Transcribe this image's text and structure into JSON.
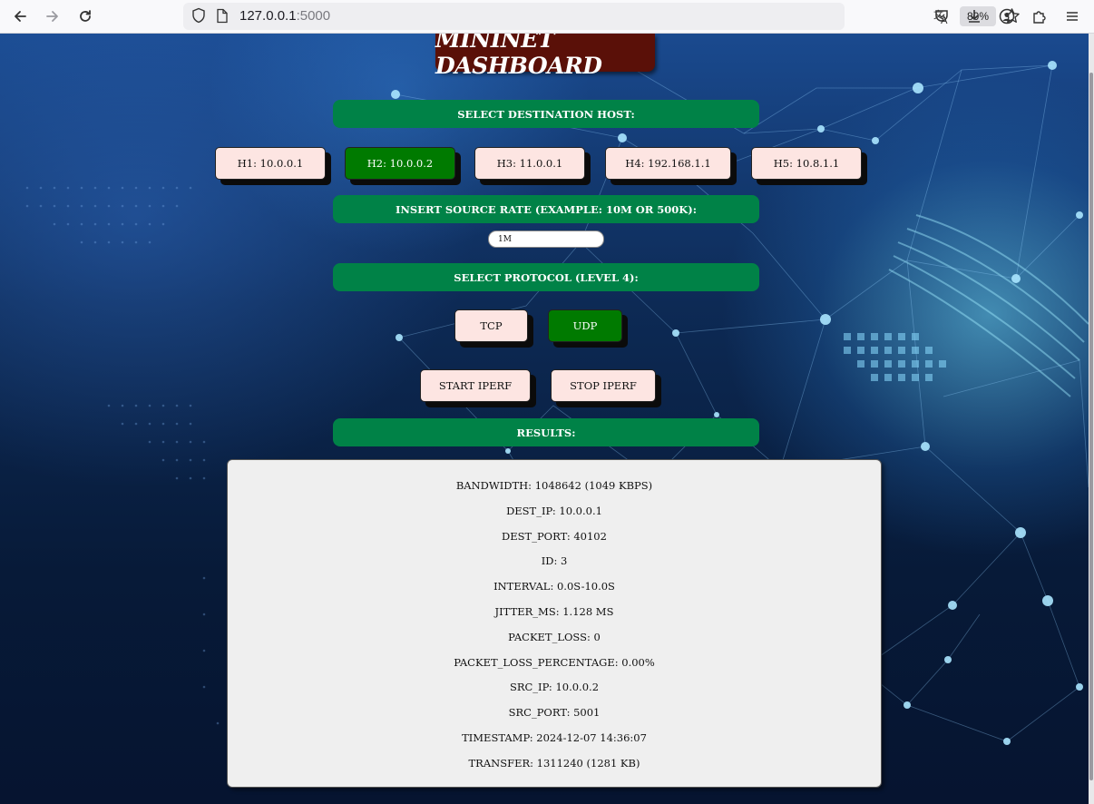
{
  "browser": {
    "url_host": "127.0.0.1",
    "url_port": ":5000",
    "zoom": "80%"
  },
  "page": {
    "title": "MININET DASHBOARD",
    "sections": {
      "destination": "SELECT DESTINATION HOST:",
      "rate": "INSERT SOURCE RATE (EXAMPLE: 10M OR 500K):",
      "protocol": "SELECT PROTOCOL (LEVEL 4):",
      "results": "RESULTS:"
    },
    "hosts": [
      {
        "label": "H1: 10.0.0.1",
        "selected": false
      },
      {
        "label": "H2: 10.0.0.2",
        "selected": true
      },
      {
        "label": "H3: 11.0.0.1",
        "selected": false
      },
      {
        "label": "H4: 192.168.1.1",
        "selected": false
      },
      {
        "label": "H5: 10.8.1.1",
        "selected": false
      }
    ],
    "rate_value": "1M",
    "protocols": [
      {
        "label": "TCP",
        "selected": false
      },
      {
        "label": "UDP",
        "selected": true
      }
    ],
    "actions": {
      "start": "START IPERF",
      "stop": "STOP IPERF"
    },
    "results": [
      "BANDWIDTH: 1048642 (1049 KBPS)",
      "DEST_IP: 10.0.0.1",
      "DEST_PORT: 40102",
      "ID: 3",
      "INTERVAL: 0.0S-10.0S",
      "JITTER_MS: 1.128 MS",
      "PACKET_LOSS: 0",
      "PACKET_LOSS_PERCENTAGE: 0.00%",
      "SRC_IP: 10.0.0.2",
      "SRC_PORT: 5001",
      "TIMESTAMP: 2024-12-07 14:36:07",
      "TRANSFER: 1311240 (1281 KB)"
    ],
    "colors": {
      "section_green": "#008247",
      "selected_green": "#007a00",
      "button_pink": "#fde5e2",
      "title_maroon": "#5a1008"
    }
  }
}
